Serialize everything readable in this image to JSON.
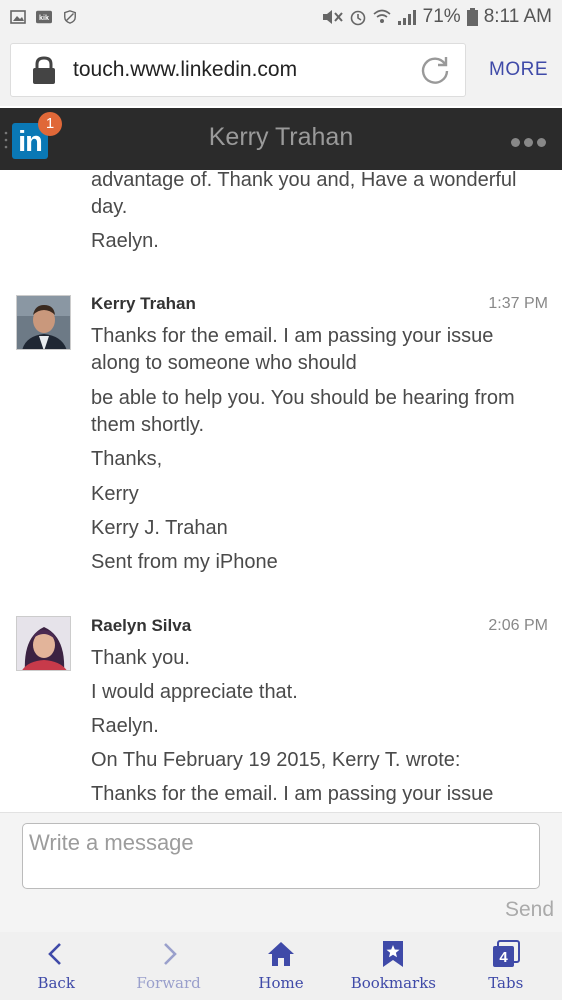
{
  "status_bar": {
    "battery": "71%",
    "time": "8:11 AM"
  },
  "browser": {
    "url": "touch.www.linkedin.com",
    "more_label": "MORE"
  },
  "header": {
    "badge_count": "1",
    "logo_text": "in",
    "title": "Kerry Trahan"
  },
  "messages": {
    "prev_tail": [
      "advantage of. Thank you and, Have a wonderful",
      "day.",
      "Raelyn."
    ],
    "msg1": {
      "sender": "Kerry Trahan",
      "time": "1:37 PM",
      "lines": [
        "Thanks for the email. I am passing your issue",
        "along to someone who should",
        "be able to help you. You should be hearing from",
        "them shortly.",
        "Thanks,",
        "Kerry",
        "Kerry J. Trahan",
        "Sent from my iPhone"
      ]
    },
    "msg2": {
      "sender": "Raelyn Silva",
      "time": "2:06 PM",
      "lines": [
        "Thank you.",
        "I would appreciate that.",
        "Raelyn.",
        "On Thu February 19 2015, Kerry T. wrote:",
        "Thanks for the email. I am passing your issue"
      ]
    }
  },
  "composer": {
    "placeholder": "Write a message",
    "send_label": "Send"
  },
  "nav": {
    "back": "Back",
    "forward": "Forward",
    "home": "Home",
    "bookmarks": "Bookmarks",
    "tabs": "Tabs",
    "tabs_count": "4"
  },
  "colors": {
    "accent": "#3f4aa8",
    "linkedin_blue": "#0a78b5",
    "badge": "#e06838",
    "header_bg": "#2b2b2b"
  }
}
